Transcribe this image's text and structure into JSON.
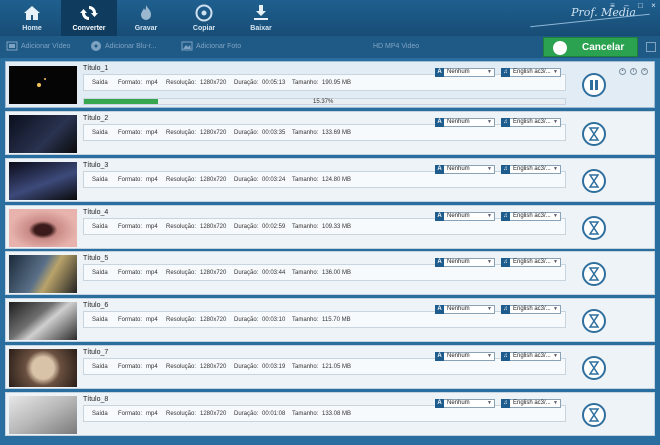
{
  "toolbar": {
    "tabs": [
      {
        "label": "Home",
        "icon": "home-icon"
      },
      {
        "label": "Converter",
        "icon": "convert-icon"
      },
      {
        "label": "Gravar",
        "icon": "burn-icon"
      },
      {
        "label": "Copiar",
        "icon": "copy-icon"
      },
      {
        "label": "Baixar",
        "icon": "download-icon"
      }
    ],
    "active_tab": "Converter",
    "brand": "Prof. Media"
  },
  "subbar": {
    "add_video": "Adicionar Vídeo",
    "add_disc": "Adicionar Blu-r...",
    "add_photo": "Adicionar Foto",
    "hd_video": "HD MP4 Video",
    "cancel": "Cancelar"
  },
  "labels": {
    "saida": "Saída",
    "formato": "Formato:",
    "resolucao": "Resolução:",
    "duracao": "Duração:",
    "tamanho": "Tamanho:",
    "subtitle_tag": "A",
    "audio_tag": "♫"
  },
  "items": [
    {
      "title": "Título_1",
      "format": "mp4",
      "resolution": "1280x720",
      "duration": "00:05:13",
      "size": "190.95 MB",
      "subtitle": "Nenhum",
      "audio": "English ac3/...",
      "status": "converting",
      "progress": 15.37,
      "progress_label": "15.37%"
    },
    {
      "title": "Título_2",
      "format": "mp4",
      "resolution": "1280x720",
      "duration": "00:03:35",
      "size": "133.69 MB",
      "subtitle": "Nenhum",
      "audio": "English ac3/...",
      "status": "waiting"
    },
    {
      "title": "Título_3",
      "format": "mp4",
      "resolution": "1280x720",
      "duration": "00:03:24",
      "size": "124.80 MB",
      "subtitle": "Nenhum",
      "audio": "English ac3/...",
      "status": "waiting"
    },
    {
      "title": "Título_4",
      "format": "mp4",
      "resolution": "1280x720",
      "duration": "00:02:59",
      "size": "109.33 MB",
      "subtitle": "Nenhum",
      "audio": "English ac3/...",
      "status": "waiting"
    },
    {
      "title": "Título_5",
      "format": "mp4",
      "resolution": "1280x720",
      "duration": "00:03:44",
      "size": "136.00 MB",
      "subtitle": "Nenhum",
      "audio": "English ac3/...",
      "status": "waiting"
    },
    {
      "title": "Título_6",
      "format": "mp4",
      "resolution": "1280x720",
      "duration": "00:03:10",
      "size": "115.70 MB",
      "subtitle": "Nenhum",
      "audio": "English ac3/...",
      "status": "waiting"
    },
    {
      "title": "Título_7",
      "format": "mp4",
      "resolution": "1280x720",
      "duration": "00:03:19",
      "size": "121.05 MB",
      "subtitle": "Nenhum",
      "audio": "English ac3/...",
      "status": "waiting"
    },
    {
      "title": "Título_8",
      "format": "mp4",
      "resolution": "1280x720",
      "duration": "00:01:08",
      "size": "133.08 MB",
      "subtitle": "Nenhum",
      "audio": "English ac3/...",
      "status": "waiting"
    }
  ],
  "colors": {
    "accent": "#2aa24f",
    "bar": "#1f5f8f",
    "action": "#2f6f9e"
  }
}
